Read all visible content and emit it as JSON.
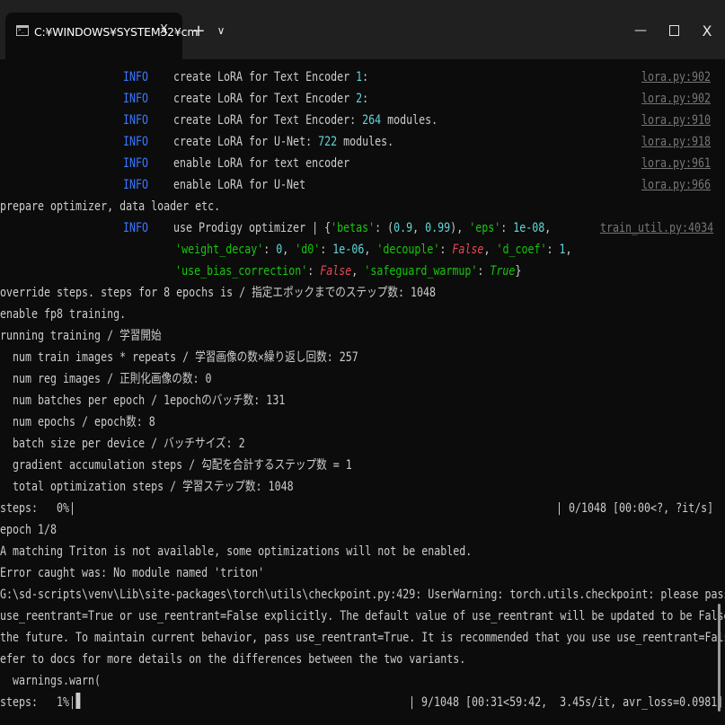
{
  "window": {
    "tab_title": "C:¥WINDOWS¥SYSTEM32¥cm",
    "tab_close": "X",
    "new_tab": "+",
    "dropdown": "∨",
    "minimize": "—",
    "close": "X"
  },
  "terminal": {
    "lines": {
      "l0": {
        "level": "INFO",
        "msg_a": "create LoRA for Text Encoder ",
        "num": "1",
        "msg_b": ":",
        "src": "lora.py:902"
      },
      "l1": {
        "level": "INFO",
        "msg_a": "create LoRA for Text Encoder ",
        "num": "2",
        "msg_b": ":",
        "src": "lora.py:902"
      },
      "l2": {
        "level": "INFO",
        "msg_a": "create LoRA for Text Encoder: ",
        "num": "264",
        "msg_b": " modules.",
        "src": "lora.py:910"
      },
      "l3": {
        "level": "INFO",
        "msg_a": "create LoRA for U-Net: ",
        "num": "722",
        "msg_b": " modules.",
        "src": "lora.py:918"
      },
      "l4": {
        "level": "INFO",
        "msg": "enable LoRA for text encoder",
        "src": "lora.py:961"
      },
      "l5": {
        "level": "INFO",
        "msg": "enable LoRA for U-Net",
        "src": "lora.py:966"
      },
      "l6": "prepare optimizer, data loader etc.",
      "l7": {
        "level": "INFO",
        "msg": "use Prodigy optimizer | {",
        "k1": "'betas'",
        "v1a": "0.9",
        "v1b": "0.99",
        "k2": "'eps'",
        "v2": "1e-08",
        "src": "train_util.py:4034"
      },
      "l8": {
        "k1": "'weight_decay'",
        "v1": "0",
        "k2": "'d0'",
        "v2": "1e-06",
        "k3": "'decouple'",
        "v3": "False",
        "k4": "'d_coef'",
        "v4": "1"
      },
      "l9": {
        "k1": "'use_bias_correction'",
        "v1": "False",
        "k2": "'safeguard_warmup'",
        "v2": "True"
      },
      "l10": "override steps. steps for 8 epochs is / 指定エポックまでのステップ数: 1048",
      "l11": "enable fp8 training.",
      "l12": "running training / 学習開始",
      "l13": "  num train images * repeats / 学習画像の数×繰り返し回数: 257",
      "l14": "  num reg images / 正則化画像の数: 0",
      "l15": "  num batches per epoch / 1epochのバッチ数: 131",
      "l16": "  num epochs / epoch数: 8",
      "l17": "  batch size per device / バッチサイズ: 2",
      "l18": "  gradient accumulation steps / 勾配を合計するステップ数 = 1",
      "l19": "  total optimization steps / 学習ステップ数: 1048",
      "l20": {
        "left": "steps:   0%|",
        "right": "| 0/1048 [00:00<?, ?it/s]"
      },
      "l21": "epoch 1/8",
      "l22": "A matching Triton is not available, some optimizations will not be enabled.",
      "l23": "Error caught was: No module named 'triton'",
      "l24": "G:\\sd-scripts\\venv\\Lib\\site-packages\\torch\\utils\\checkpoint.py:429: UserWarning: torch.utils.checkpoint: please pass in",
      "l25": "use_reentrant=True or use_reentrant=False explicitly. The default value of use_reentrant will be updated to be False in",
      "l26": "the future. To maintain current behavior, pass use_reentrant=True. It is recommended that you use use_reentrant=False. R",
      "l27": "efer to docs for more details on the differences between the two variants.",
      "l28": "  warnings.warn(",
      "l29": {
        "left": "steps:   1%|",
        "right": "| 9/1048 [00:31<59:42,  3.45s/it, avr_loss=0.0981]"
      }
    }
  },
  "colors": {
    "background": "#0c0c0c",
    "titlebar": "#202020",
    "text": "#cccccc",
    "info": "#3b78ff",
    "number": "#61d6d6",
    "string": "#16c60c",
    "keyword_false": "#e74856",
    "source_link": "#767676"
  }
}
